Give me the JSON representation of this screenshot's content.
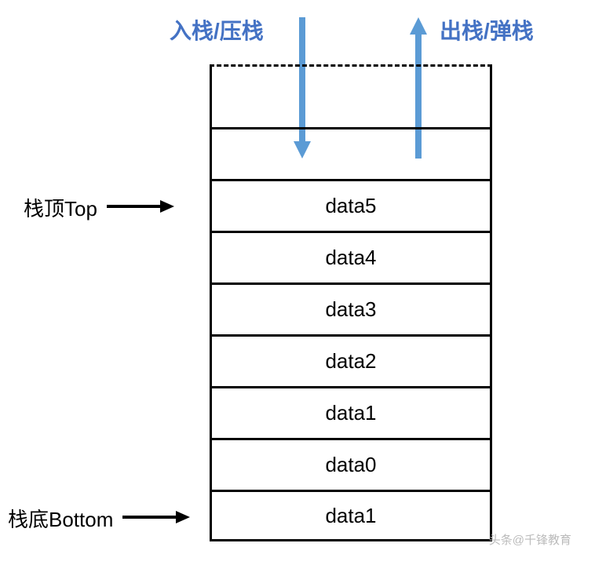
{
  "labels": {
    "push": "入栈/压栈",
    "pop": "出栈/弹栈",
    "top": "栈顶Top",
    "bottom": "栈底Bottom"
  },
  "stack": {
    "cells": [
      {
        "value": ""
      },
      {
        "value": "data5"
      },
      {
        "value": "data4"
      },
      {
        "value": "data3"
      },
      {
        "value": "data2"
      },
      {
        "value": "data1"
      },
      {
        "value": "data0"
      },
      {
        "value": "data1"
      }
    ]
  },
  "colors": {
    "arrow": "#5b9bd5",
    "label": "#4472c4"
  },
  "watermark": "头条@千锋教育"
}
